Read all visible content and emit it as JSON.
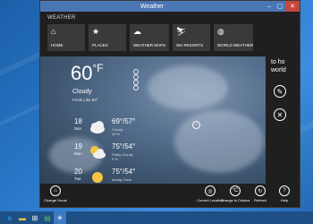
{
  "window": {
    "title": "Weather"
  },
  "nav": {
    "app_label": "WEATHER",
    "items": [
      {
        "label": "HOME",
        "icon": "home-icon"
      },
      {
        "label": "PLACES",
        "icon": "star-icon"
      },
      {
        "label": "WEATHER MAPS",
        "icon": "map-icon"
      },
      {
        "label": "SKI RESORTS",
        "icon": "ski-icon"
      },
      {
        "label": "WORLD WEATHER",
        "icon": "globe-icon"
      }
    ]
  },
  "current": {
    "temp": "60",
    "unit": "°F",
    "condition": "Cloudy",
    "feels_like": "Feels Like 60°",
    "extras": [
      "",
      "",
      "",
      ""
    ]
  },
  "forecast": [
    {
      "day": "18",
      "dname": "Sun",
      "hilo": "69°/57°",
      "cond": "Cloudy",
      "precip": "40 %"
    },
    {
      "day": "19",
      "dname": "Mon",
      "hilo": "75°/54°",
      "cond": "Partly Cloudy",
      "precip": "0 %"
    },
    {
      "day": "20",
      "dname": "Tue",
      "hilo": "75°/54°",
      "cond": "Mostly Clear",
      "precip": ""
    }
  ],
  "side_panel": {
    "title_lines": [
      "to ho",
      "world"
    ]
  },
  "appbar": {
    "buttons": [
      {
        "label": "Change Home",
        "icon": "home-icon"
      },
      {
        "label": "Current Location",
        "icon": "location-icon"
      },
      {
        "label": "Change to Celsius",
        "icon": "celsius-icon"
      },
      {
        "label": "Refresh",
        "icon": "refresh-icon"
      },
      {
        "label": "Help",
        "icon": "help-icon"
      }
    ]
  },
  "taskbar": {
    "items": [
      "ie-icon",
      "folder-icon",
      "store-icon",
      "mail-icon",
      "weather-app-icon"
    ]
  }
}
